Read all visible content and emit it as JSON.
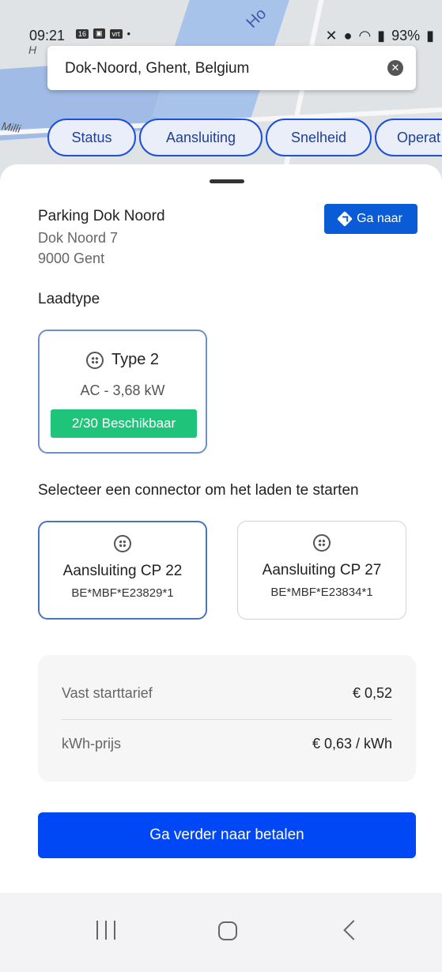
{
  "status_bar": {
    "time": "09:21",
    "badge_16": "16",
    "badge_vrt": "vrt",
    "dot": "•",
    "battery": "93%"
  },
  "map": {
    "label_ho": "Ho",
    "label_h": "H",
    "label_mil": "Milli"
  },
  "search": {
    "value": "Dok-Noord, Ghent, Belgium"
  },
  "filters": [
    "Status",
    "Aansluiting",
    "Snelheid",
    "Operat"
  ],
  "location": {
    "name": "Parking Dok Noord",
    "street": "Dok Noord 7",
    "city": "9000 Gent",
    "goto_label": "Ga naar"
  },
  "charge_type": {
    "heading": "Laadtype",
    "type": "Type 2",
    "power": "AC - 3,68 kW",
    "availability": "2/30 Beschikbaar"
  },
  "connectors": {
    "heading": "Selecteer een connector om het laden te starten",
    "items": [
      {
        "name": "Aansluiting CP 22",
        "code": "BE*MBF*E23829*1",
        "selected": true
      },
      {
        "name": "Aansluiting CP 27",
        "code": "BE*MBF*E23834*1",
        "selected": false
      }
    ]
  },
  "pricing": {
    "start_label": "Vast starttarief",
    "start_value": "€ 0,52",
    "kwh_label": "kWh-prijs",
    "kwh_value": "€ 0,63 / kWh"
  },
  "pay_button": "Ga verder naar betalen",
  "colors": {
    "accent": "#0047f5",
    "goto": "#0a5bd6",
    "available": "#1ec47a"
  }
}
